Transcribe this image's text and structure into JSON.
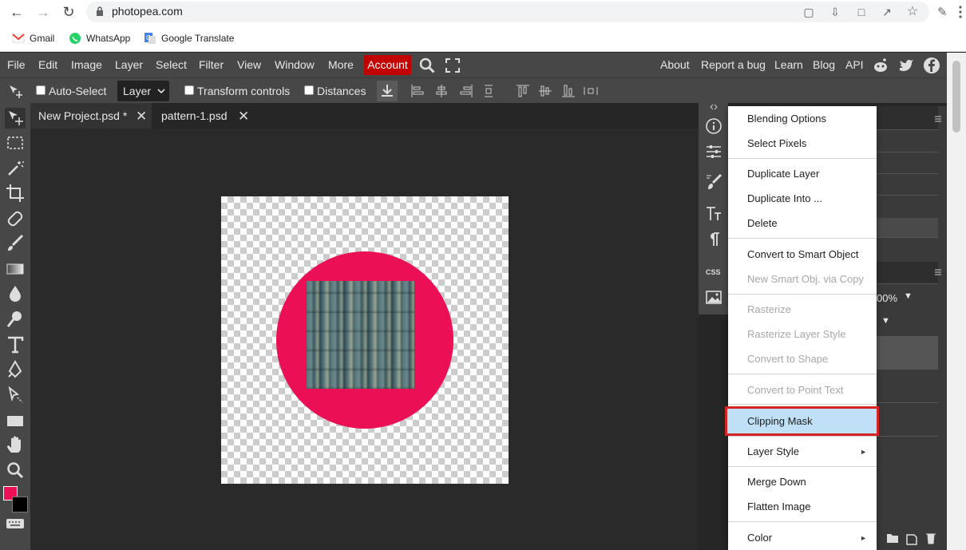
{
  "browser": {
    "url": "photopea.com",
    "bookmarks": [
      "Gmail",
      "WhatsApp",
      "Google Translate"
    ]
  },
  "menu": {
    "items": [
      "File",
      "Edit",
      "Image",
      "Layer",
      "Select",
      "Filter",
      "View",
      "Window",
      "More"
    ],
    "account": "Account",
    "right_links": [
      "About",
      "Report a bug",
      "Learn",
      "Blog",
      "API"
    ]
  },
  "options": {
    "auto_select": "Auto-Select",
    "layer_mode": "Layer",
    "transform_controls": "Transform controls",
    "distances": "Distances"
  },
  "tabs": [
    {
      "label": "New Project.psd *",
      "active": true
    },
    {
      "label": "pattern-1.psd",
      "active": false
    }
  ],
  "colors": {
    "foreground": "#eb0f55",
    "background": "#000000",
    "circle": "#eb0f55",
    "accent": "#c30000"
  },
  "right_panel": {
    "opacity_value": "00%"
  },
  "context_menu": {
    "items": [
      {
        "label": "Blending Options",
        "disabled": false
      },
      {
        "label": "Select Pixels",
        "disabled": false
      },
      {
        "label": "Duplicate Layer",
        "disabled": false
      },
      {
        "label": "Duplicate Into ...",
        "disabled": false
      },
      {
        "label": "Delete",
        "disabled": false
      },
      {
        "label": "Convert to Smart Object",
        "disabled": false
      },
      {
        "label": "New Smart Obj. via Copy",
        "disabled": true
      },
      {
        "label": "Rasterize",
        "disabled": true
      },
      {
        "label": "Rasterize Layer Style",
        "disabled": true
      },
      {
        "label": "Convert to Shape",
        "disabled": true
      },
      {
        "label": "Convert to Point Text",
        "disabled": true
      },
      {
        "label": "Clipping Mask",
        "disabled": false,
        "highlighted": true
      },
      {
        "label": "Layer Style",
        "disabled": false,
        "submenu": true
      },
      {
        "label": "Merge Down",
        "disabled": false
      },
      {
        "label": "Flatten Image",
        "disabled": false
      },
      {
        "label": "Color",
        "disabled": false,
        "submenu": true
      }
    ]
  }
}
